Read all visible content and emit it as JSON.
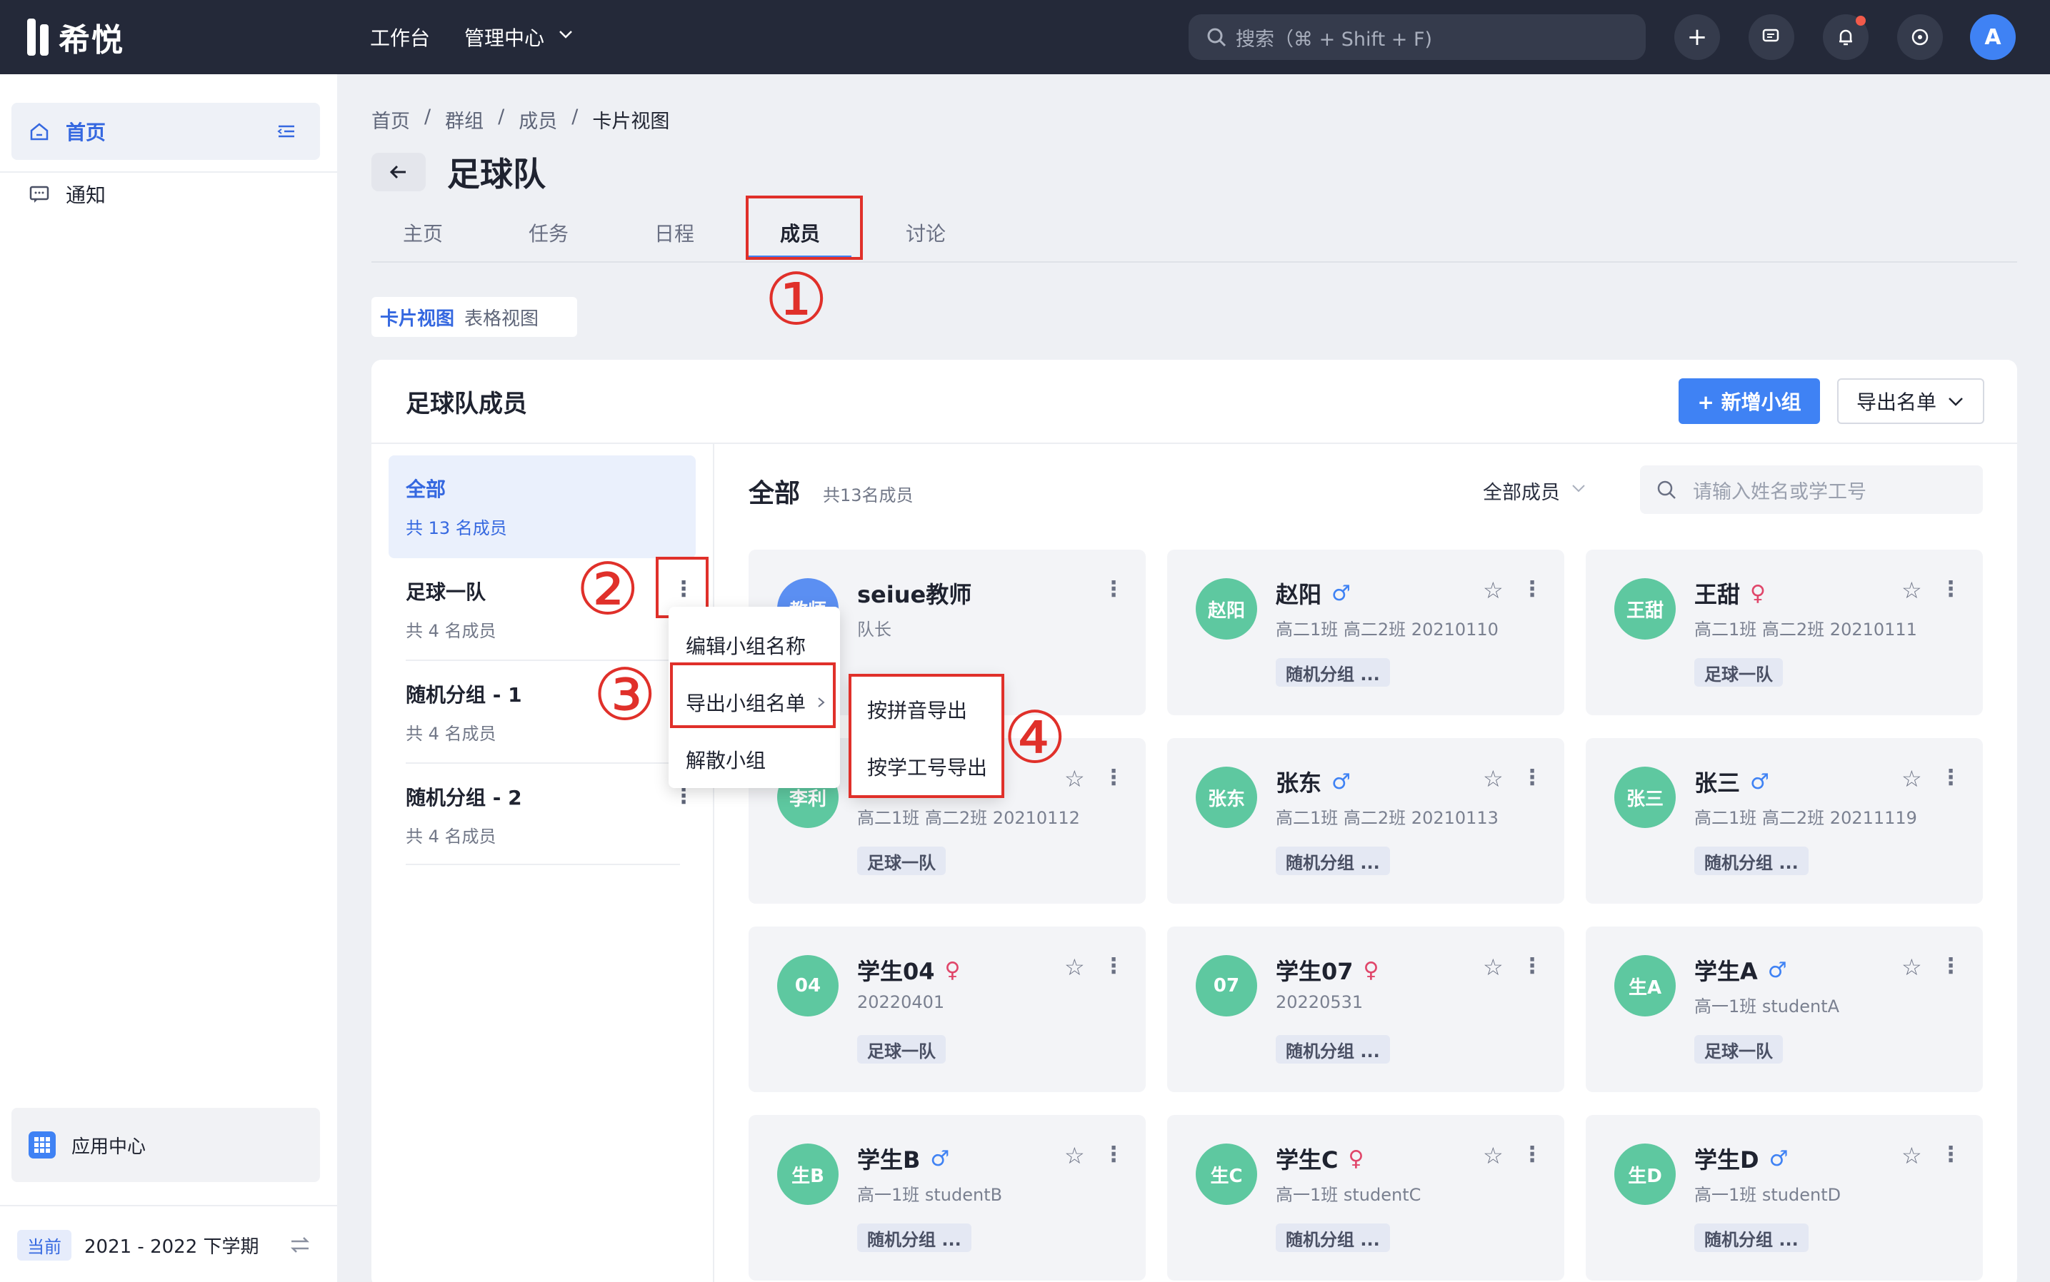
{
  "topbar": {
    "logo_text": "希悦",
    "nav_workbench": "工作台",
    "nav_admin": "管理中心",
    "search_placeholder": "搜索（⌘ + Shift + F)",
    "avatar_letter": "A"
  },
  "sidebar": {
    "items": [
      {
        "label": "首页",
        "icon": "home-icon"
      },
      {
        "label": "通知",
        "icon": "message-icon"
      }
    ],
    "app_center": "应用中心",
    "term_badge": "当前",
    "term_label": "2021 - 2022 下学期"
  },
  "breadcrumb": [
    "首页",
    "群组",
    "成员",
    "卡片视图"
  ],
  "page_title": "足球队",
  "tabs": [
    "主页",
    "任务",
    "日程",
    "成员",
    "讨论"
  ],
  "active_tab": "成员",
  "view_toggle": {
    "card": "卡片视图",
    "table": "表格视图"
  },
  "panel": {
    "title": "足球队成员",
    "new_group_button": "+ 新增小组",
    "export_button": "导出名单"
  },
  "groups": [
    {
      "name": "全部",
      "count": "共 13 名成员"
    },
    {
      "name": "足球一队",
      "count": "共 4 名成员"
    },
    {
      "name": "随机分组 - 1",
      "count": "共 4 名成员"
    },
    {
      "name": "随机分组 - 2",
      "count": "共 4 名成员"
    }
  ],
  "members_header": {
    "title": "全部",
    "count": "共13名成员",
    "filter": "全部成员",
    "search_placeholder": "请输入姓名或学工号"
  },
  "group_menu": [
    "编辑小组名称",
    "导出小组名单",
    "解散小组"
  ],
  "export_submenu": [
    "按拼音导出",
    "按学工号导出"
  ],
  "annotations": [
    "①",
    "②",
    "③",
    "④"
  ],
  "cards": [
    {
      "avatar": "教师",
      "name": "seiue教师",
      "gender": "",
      "info": "队长",
      "tag": ""
    },
    {
      "avatar": "赵阳",
      "name": "赵阳",
      "gender": "♂",
      "info": "高二1班 高二2班 20210110",
      "tag": "随机分组 ..."
    },
    {
      "avatar": "王甜",
      "name": "王甜",
      "gender": "♀",
      "info": "高二1班 高二2班 20210111",
      "tag": "足球一队"
    },
    {
      "avatar": "李利",
      "name": "李利",
      "gender": "",
      "info": "高二1班 高二2班 20210112",
      "tag": "足球一队"
    },
    {
      "avatar": "张东",
      "name": "张东",
      "gender": "♂",
      "info": "高二1班 高二2班 20210113",
      "tag": "随机分组 ..."
    },
    {
      "avatar": "张三",
      "name": "张三",
      "gender": "♂",
      "info": "高二1班 高二2班 20211119",
      "tag": "随机分组 ..."
    },
    {
      "avatar": "04",
      "name": "学生04",
      "gender": "♀",
      "info": "20220401",
      "tag": "足球一队"
    },
    {
      "avatar": "07",
      "name": "学生07",
      "gender": "♀",
      "info": "20220531",
      "tag": "随机分组 ..."
    },
    {
      "avatar": "生A",
      "name": "学生A",
      "gender": "♂",
      "info": "高一1班 studentA",
      "tag": "足球一队"
    },
    {
      "avatar": "生B",
      "name": "学生B",
      "gender": "♂",
      "info": "高一1班 studentB",
      "tag": "随机分组 ..."
    },
    {
      "avatar": "生C",
      "name": "学生C",
      "gender": "♀",
      "info": "高一1班 studentC",
      "tag": "随机分组 ..."
    },
    {
      "avatar": "生D",
      "name": "学生D",
      "gender": "♂",
      "info": "高一1班 studentD",
      "tag": "随机分组 ..."
    }
  ]
}
